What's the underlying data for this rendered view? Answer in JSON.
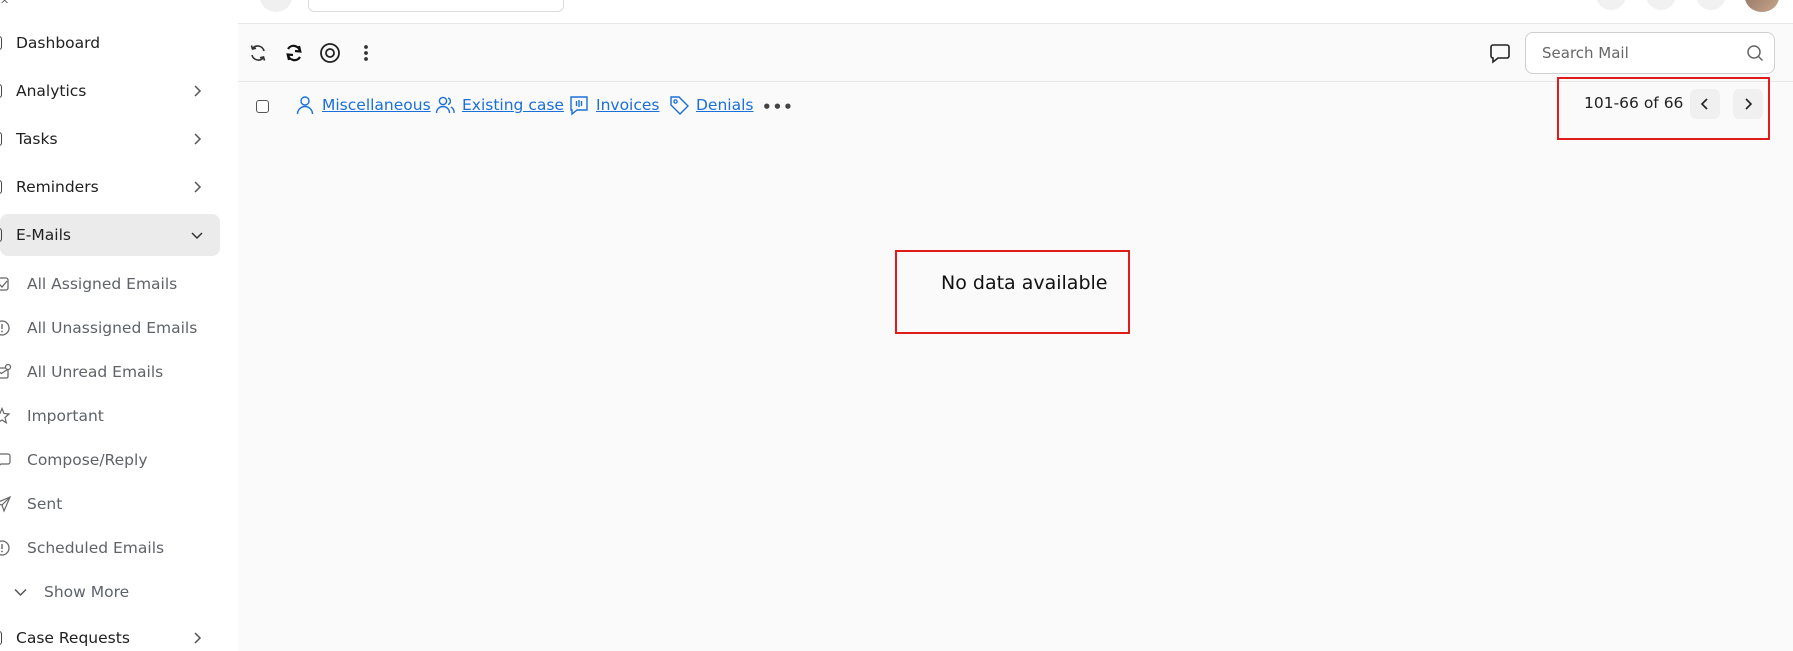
{
  "sidebar": {
    "items": [
      {
        "label": "Dashboard"
      },
      {
        "label": "Analytics"
      },
      {
        "label": "Tasks"
      },
      {
        "label": "Reminders"
      },
      {
        "label": "E-Mails"
      }
    ],
    "emails_sub": [
      {
        "label": "All Assigned Emails",
        "icon": "check-square-icon"
      },
      {
        "label": "All Unassigned Emails",
        "icon": "alert-circle-icon"
      },
      {
        "label": "All Unread Emails",
        "icon": "mail-unread-icon"
      },
      {
        "label": "Important",
        "icon": "star-icon"
      },
      {
        "label": "Compose/Reply",
        "icon": "message-icon"
      },
      {
        "label": "Sent",
        "icon": "send-icon"
      },
      {
        "label": "Scheduled Emails",
        "icon": "alert-circle-icon"
      }
    ],
    "show_more": "Show More",
    "case_requests": "Case Requests"
  },
  "toolbar": {
    "search_placeholder": "Search Mail"
  },
  "filters": {
    "chips": [
      {
        "label": "Miscellaneous",
        "icon": "user-icon"
      },
      {
        "label": "Existing case",
        "icon": "users-icon"
      },
      {
        "label": "Invoices",
        "icon": "invoice-icon"
      },
      {
        "label": "Denials",
        "icon": "tag-icon"
      }
    ]
  },
  "pager": {
    "text": "101-66 of 66"
  },
  "main": {
    "empty_text": "No data available"
  },
  "colors": {
    "link": "#1a6fd8",
    "highlight": "#e01b1b"
  }
}
